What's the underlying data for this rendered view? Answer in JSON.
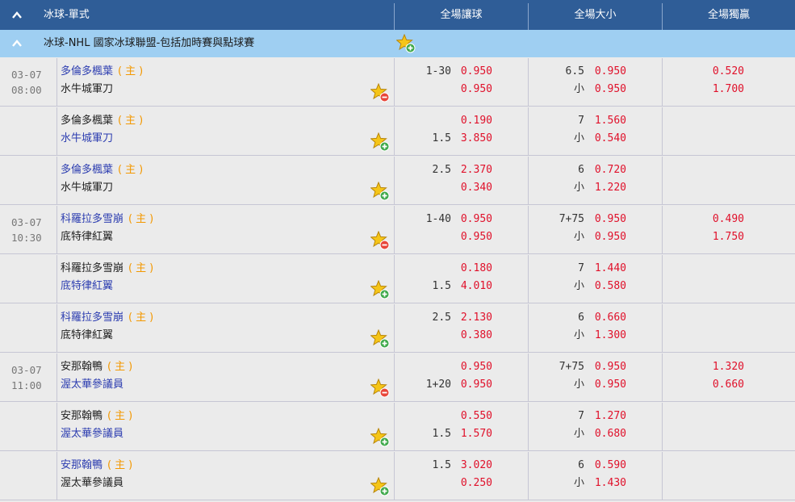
{
  "header": {
    "title": "冰球-單式",
    "col1": "全場讓球",
    "col2": "全場大小",
    "col3": "全場獨贏"
  },
  "league": {
    "name": "冰球-NHL 國家冰球聯盟-包括加時賽與點球賽"
  },
  "home_tag": "(主)",
  "colors": {
    "header_bg": "#2f5d97",
    "league_bg": "#9fcff2",
    "odds": "#e0102a",
    "home": "#f39800",
    "team_link": "#2c3db0"
  },
  "rows": [
    {
      "date": "03-07",
      "time": "08:00",
      "home": "多倫多楓葉",
      "away": "水牛城軍刀",
      "home_style": "blue",
      "away_style": "black",
      "fav_icon": "star-minus-icon",
      "hcap_top": "1-30",
      "hcap_top_odds": "0.950",
      "hcap_bot": "",
      "hcap_bot_odds": "0.950",
      "ou_top": "6.5",
      "ou_top_odds": "0.950",
      "ou_bot": "小",
      "ou_bot_odds": "0.950",
      "ml_top": "0.520",
      "ml_bot": "1.700"
    },
    {
      "date": "",
      "time": "",
      "home": "多倫多楓葉",
      "away": "水牛城軍刀",
      "home_style": "black",
      "away_style": "blue",
      "fav_icon": "star-plus-icon",
      "hcap_top": "",
      "hcap_top_odds": "0.190",
      "hcap_bot": "1.5",
      "hcap_bot_odds": "3.850",
      "ou_top": "7",
      "ou_top_odds": "1.560",
      "ou_bot": "小",
      "ou_bot_odds": "0.540",
      "ml_top": "",
      "ml_bot": ""
    },
    {
      "date": "",
      "time": "",
      "home": "多倫多楓葉",
      "away": "水牛城軍刀",
      "home_style": "blue",
      "away_style": "black",
      "fav_icon": "star-plus-icon",
      "hcap_top": "2.5",
      "hcap_top_odds": "2.370",
      "hcap_bot": "",
      "hcap_bot_odds": "0.340",
      "ou_top": "6",
      "ou_top_odds": "0.720",
      "ou_bot": "小",
      "ou_bot_odds": "1.220",
      "ml_top": "",
      "ml_bot": ""
    },
    {
      "date": "03-07",
      "time": "10:30",
      "home": "科羅拉多雪崩",
      "away": "底特律紅翼",
      "home_style": "blue",
      "away_style": "black",
      "fav_icon": "star-minus-icon",
      "hcap_top": "1-40",
      "hcap_top_odds": "0.950",
      "hcap_bot": "",
      "hcap_bot_odds": "0.950",
      "ou_top": "7+75",
      "ou_top_odds": "0.950",
      "ou_bot": "小",
      "ou_bot_odds": "0.950",
      "ml_top": "0.490",
      "ml_bot": "1.750"
    },
    {
      "date": "",
      "time": "",
      "home": "科羅拉多雪崩",
      "away": "底特律紅翼",
      "home_style": "black",
      "away_style": "blue",
      "fav_icon": "star-plus-icon",
      "hcap_top": "",
      "hcap_top_odds": "0.180",
      "hcap_bot": "1.5",
      "hcap_bot_odds": "4.010",
      "ou_top": "7",
      "ou_top_odds": "1.440",
      "ou_bot": "小",
      "ou_bot_odds": "0.580",
      "ml_top": "",
      "ml_bot": ""
    },
    {
      "date": "",
      "time": "",
      "home": "科羅拉多雪崩",
      "away": "底特律紅翼",
      "home_style": "blue",
      "away_style": "black",
      "fav_icon": "star-plus-icon",
      "hcap_top": "2.5",
      "hcap_top_odds": "2.130",
      "hcap_bot": "",
      "hcap_bot_odds": "0.380",
      "ou_top": "6",
      "ou_top_odds": "0.660",
      "ou_bot": "小",
      "ou_bot_odds": "1.300",
      "ml_top": "",
      "ml_bot": ""
    },
    {
      "date": "03-07",
      "time": "11:00",
      "home": "安那翰鴨",
      "away": "渥太華參議員",
      "home_style": "black",
      "away_style": "blue",
      "fav_icon": "star-minus-icon",
      "hcap_top": "",
      "hcap_top_odds": "0.950",
      "hcap_bot": "1+20",
      "hcap_bot_odds": "0.950",
      "ou_top": "7+75",
      "ou_top_odds": "0.950",
      "ou_bot": "小",
      "ou_bot_odds": "0.950",
      "ml_top": "1.320",
      "ml_bot": "0.660"
    },
    {
      "date": "",
      "time": "",
      "home": "安那翰鴨",
      "away": "渥太華參議員",
      "home_style": "black",
      "away_style": "blue",
      "fav_icon": "star-plus-icon",
      "hcap_top": "",
      "hcap_top_odds": "0.550",
      "hcap_bot": "1.5",
      "hcap_bot_odds": "1.570",
      "ou_top": "7",
      "ou_top_odds": "1.270",
      "ou_bot": "小",
      "ou_bot_odds": "0.680",
      "ml_top": "",
      "ml_bot": ""
    },
    {
      "date": "",
      "time": "",
      "home": "安那翰鴨",
      "away": "渥太華參議員",
      "home_style": "blue",
      "away_style": "black",
      "fav_icon": "star-plus-icon",
      "hcap_top": "1.5",
      "hcap_top_odds": "3.020",
      "hcap_bot": "",
      "hcap_bot_odds": "0.250",
      "ou_top": "6",
      "ou_top_odds": "0.590",
      "ou_bot": "小",
      "ou_bot_odds": "1.430",
      "ml_top": "",
      "ml_bot": ""
    }
  ]
}
